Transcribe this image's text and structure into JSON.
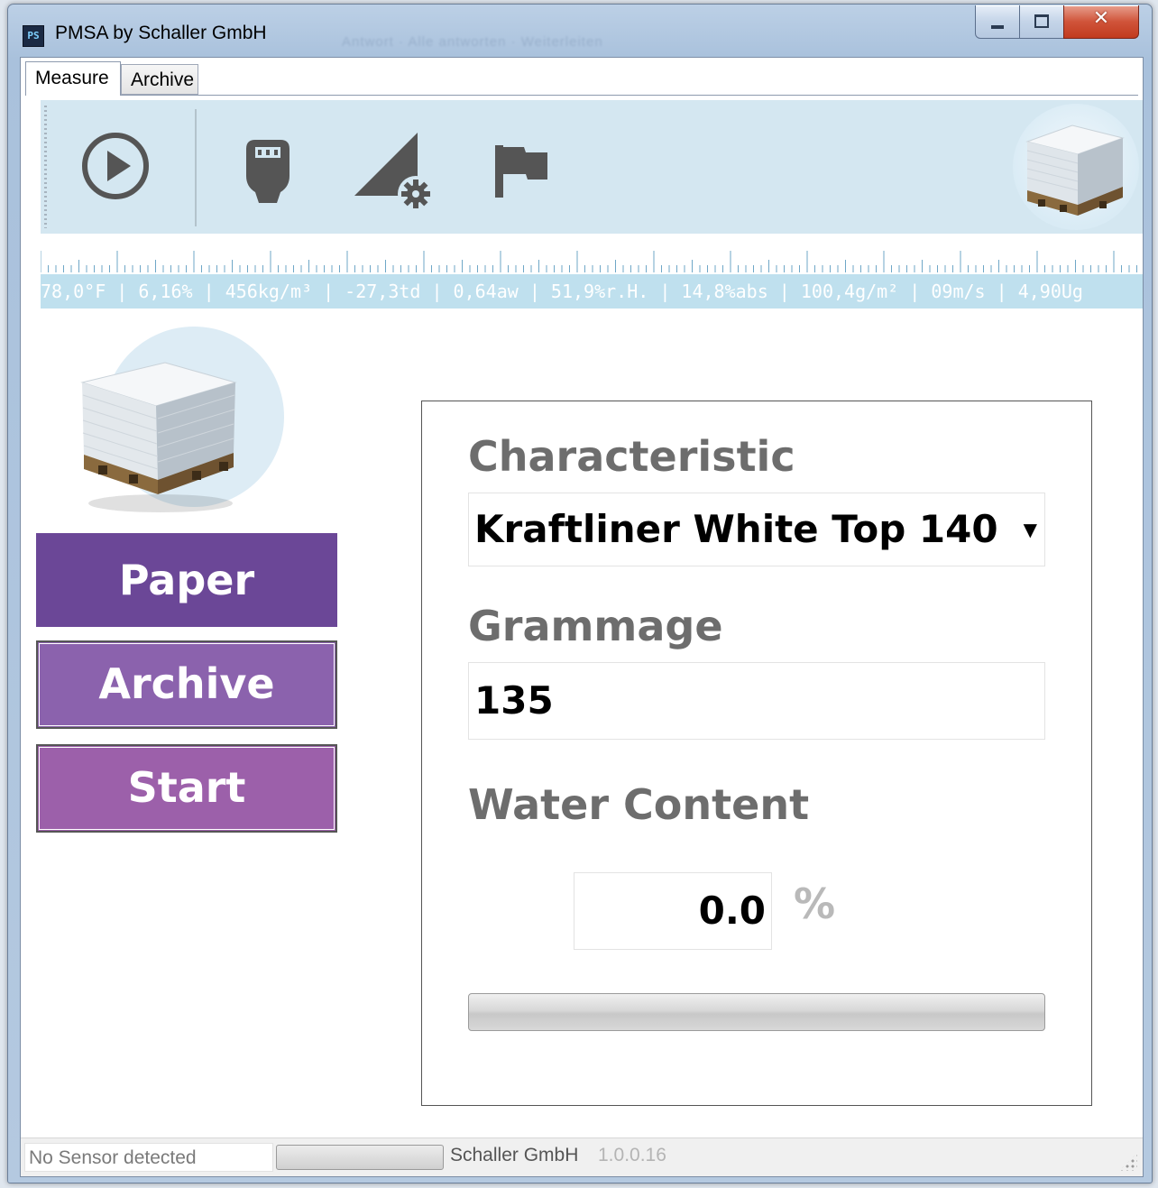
{
  "window": {
    "title": "PMSA by Schaller GmbH",
    "icon_label": "PS",
    "title_ghost": "Antwort · Alle antworten · Weiterleiten"
  },
  "window_controls": {
    "close_glyph": "✕"
  },
  "tabs": [
    {
      "label": "Measure",
      "active": true
    },
    {
      "label": "Archive",
      "active": false
    }
  ],
  "toolbar": {
    "items": [
      "play-icon",
      "sensor-plug-icon",
      "calibration-settings-icon",
      "flag-icon"
    ]
  },
  "ticker": {
    "text": "78,0°F | 6,16% | 456kg/m³ | -27,3td | 0,64aw | 51,9%r.H. | 14,8%abs | 100,4g/m² | 09m/s | 4,90Ug"
  },
  "nav": {
    "paper": "Paper",
    "archive": "Archive",
    "start": "Start"
  },
  "panel": {
    "characteristic_label": "Characteristic",
    "characteristic_value": "Kraftliner White Top 140",
    "grammage_label": "Grammage",
    "grammage_value": "135",
    "water_label": "Water Content",
    "water_value": "0.0",
    "water_unit": "%",
    "progress": 0
  },
  "status": {
    "sensor": "No Sensor detected",
    "company": "Schaller GmbH",
    "version": "1.0.0.16"
  },
  "colors": {
    "paper_btn": "#6b4797",
    "archive_btn": "#8b62ad",
    "start_btn": "#9c60aa",
    "toolbar_bg": "#d4e7f1",
    "ticker_bg": "#bfe0ee"
  }
}
